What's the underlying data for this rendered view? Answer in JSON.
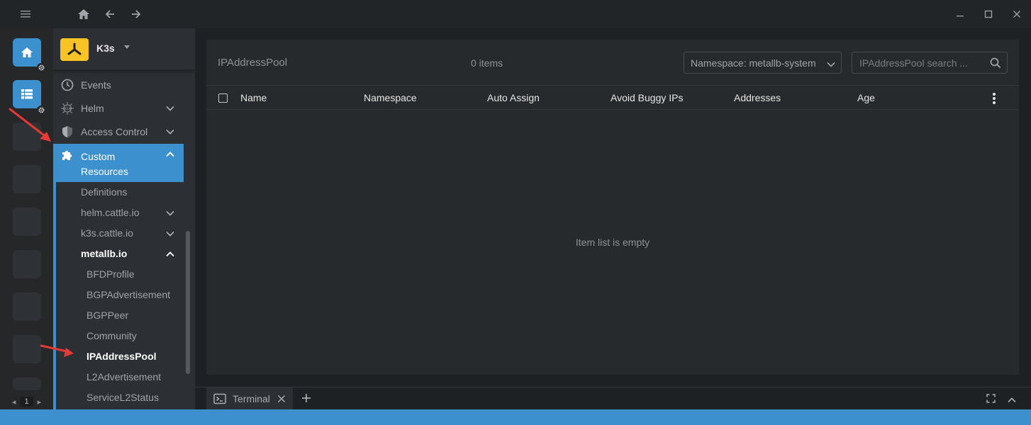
{
  "window": {
    "controls": [
      "minimize-icon",
      "maximize-icon",
      "close-icon"
    ]
  },
  "titlebar": {
    "menu_icon": "hamburger-icon",
    "nav_icons": [
      "home-icon",
      "arrow-left-icon",
      "arrow-right-icon"
    ]
  },
  "hotbar": {
    "page": "1"
  },
  "cluster": {
    "name": "K3s"
  },
  "sidebar": {
    "items": [
      {
        "label": "Events",
        "icon": "clock-icon"
      },
      {
        "label": "Helm",
        "icon": "helm-icon"
      },
      {
        "label": "Access Control",
        "icon": "shield-icon"
      },
      {
        "label": "Custom Resources",
        "icon": "puzzle-icon"
      }
    ],
    "custom_resources": {
      "definitions": "Definitions",
      "groups": [
        {
          "label": "helm.cattle.io"
        },
        {
          "label": "k3s.cattle.io"
        },
        {
          "label": "metallb.io"
        }
      ],
      "metallb": [
        "BFDProfile",
        "BGPAdvertisement",
        "BGPPeer",
        "Community",
        "IPAddressPool",
        "L2Advertisement",
        "ServiceL2Status"
      ]
    }
  },
  "main": {
    "title": "IPAddressPool",
    "count": "0 items",
    "namespace_select": "Namespace: metallb-system",
    "search_placeholder": "IPAddressPool search ...",
    "columns": [
      "Name",
      "Namespace",
      "Auto Assign",
      "Avoid Buggy IPs",
      "Addresses",
      "Age"
    ],
    "empty_message": "Item list is empty"
  },
  "dock": {
    "tab_label": "Terminal"
  },
  "colors": {
    "accent": "#3d90ce",
    "cluster_logo": "#f7c325",
    "annotation_arrow": "#e53935"
  }
}
